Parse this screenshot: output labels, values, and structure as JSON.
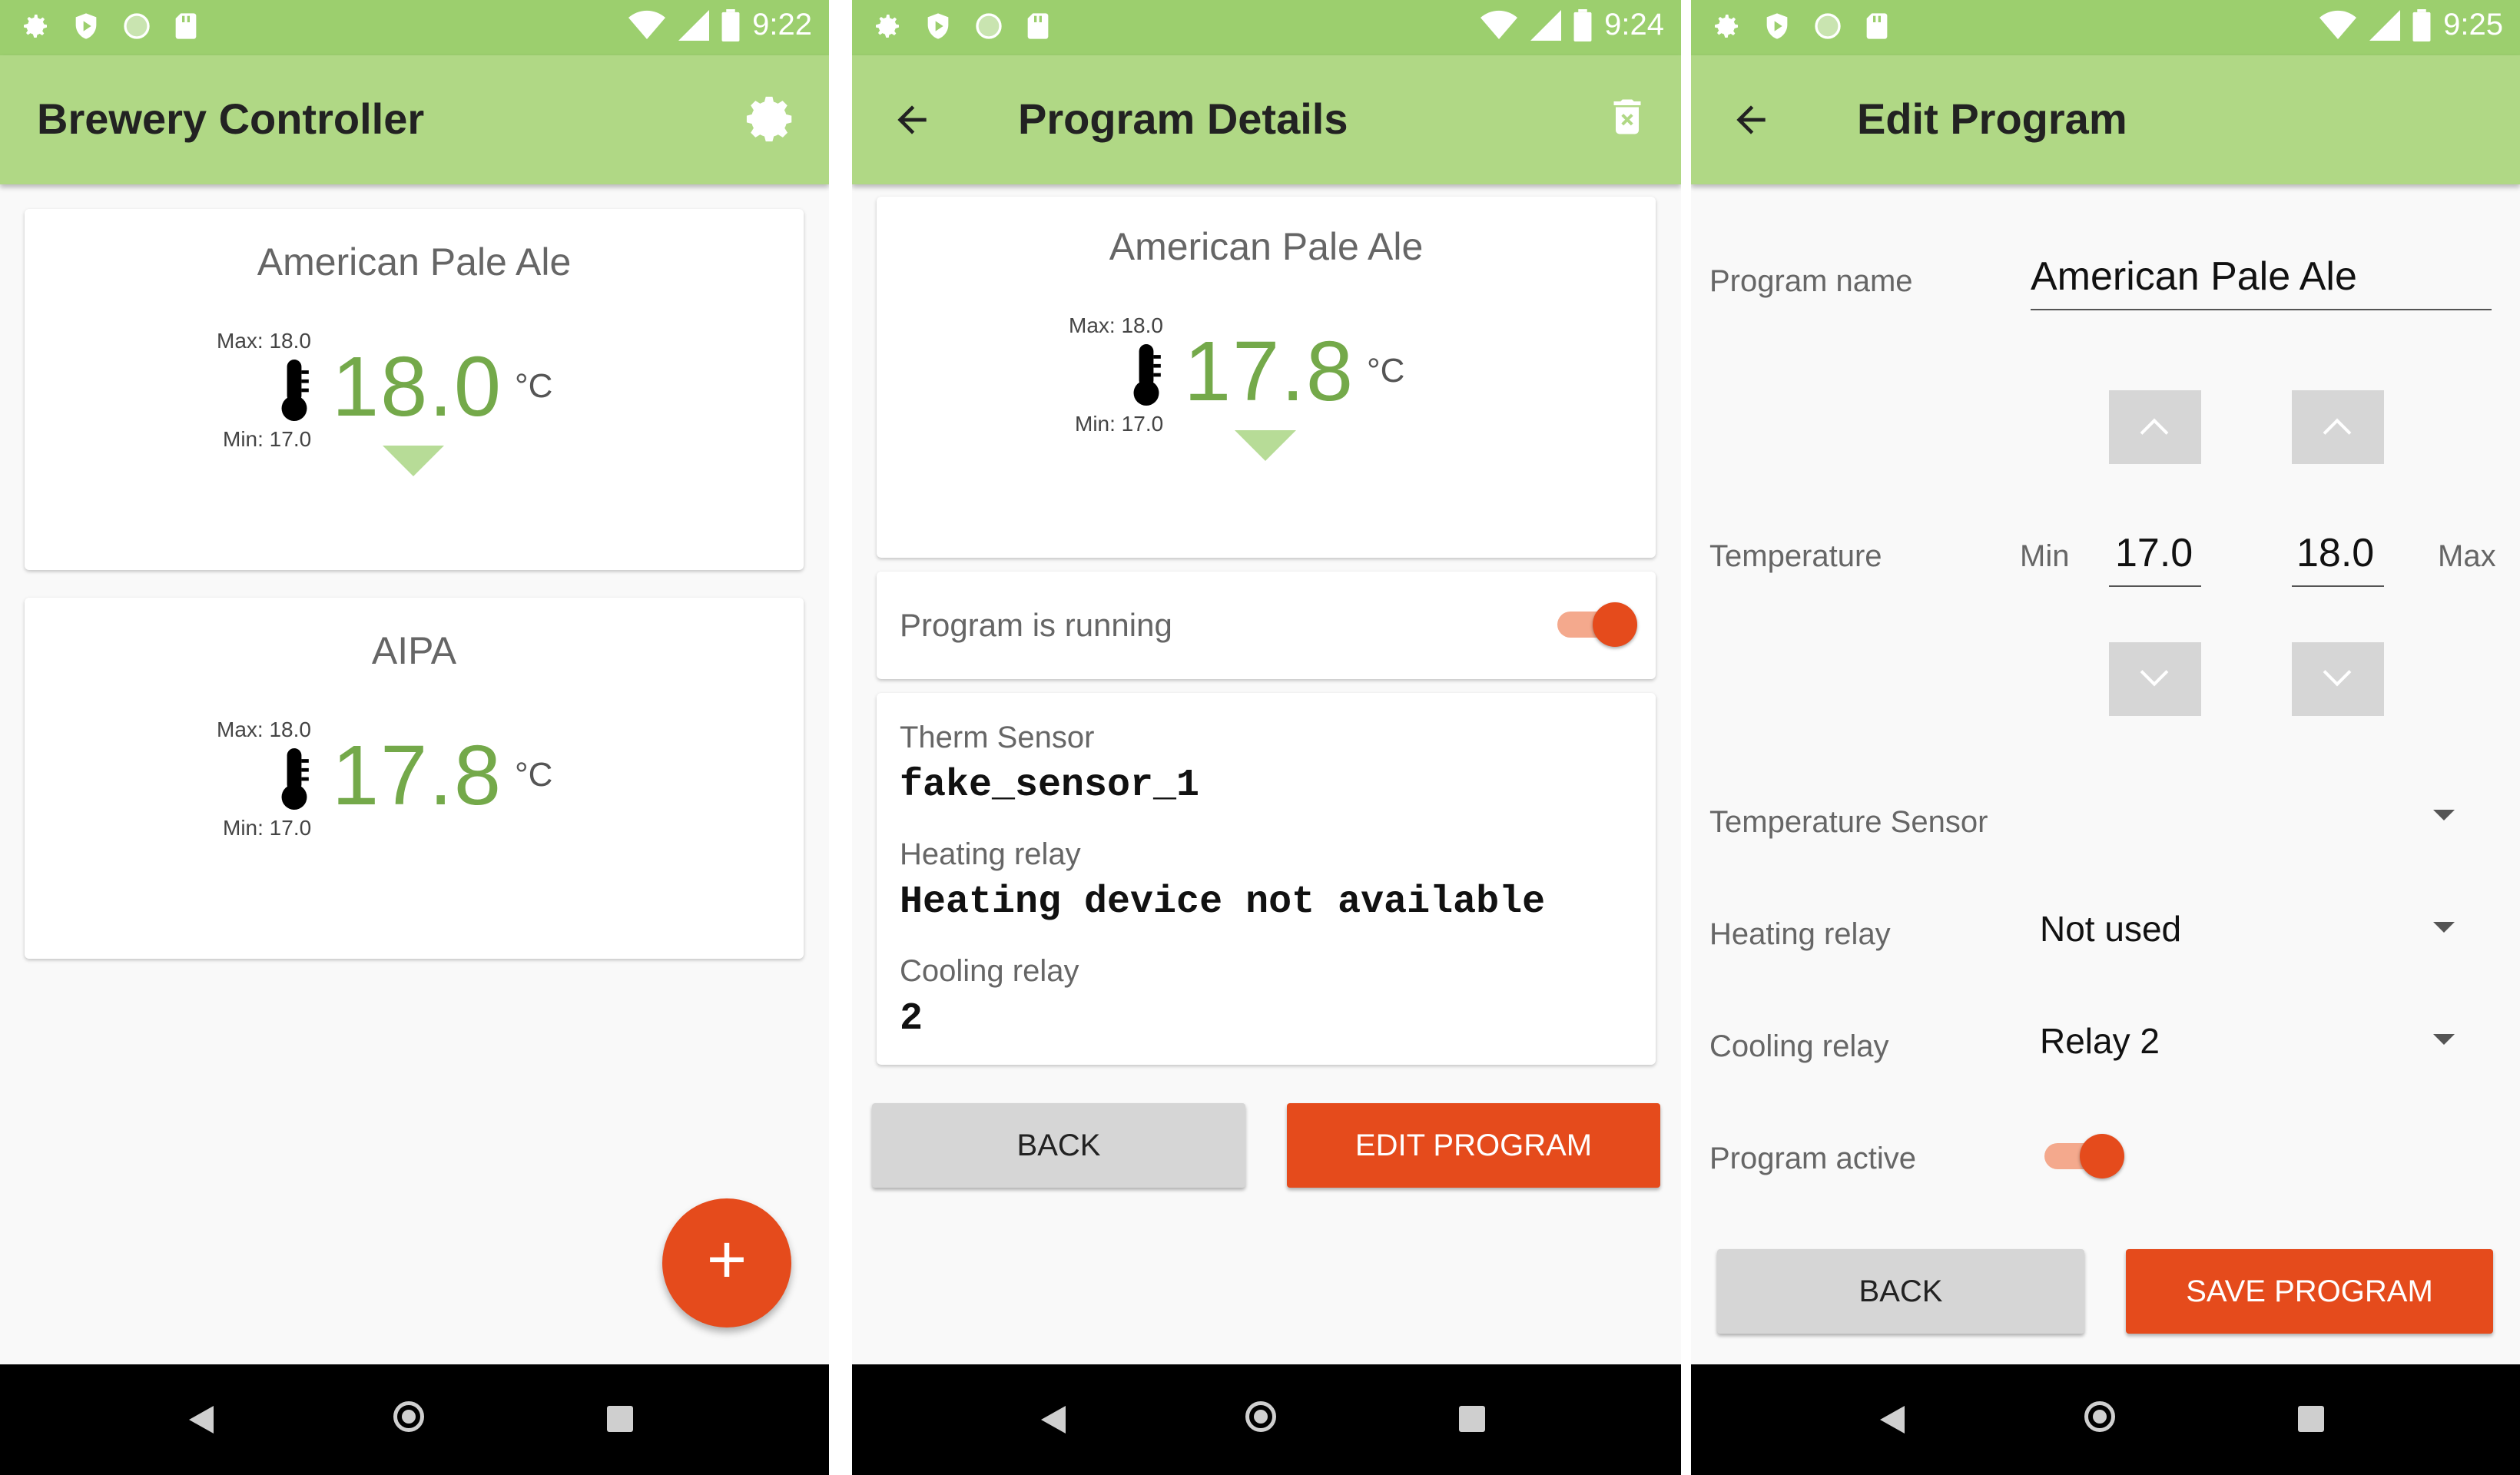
{
  "screen1": {
    "status": {
      "time": "9:22"
    },
    "appbar": {
      "title": "Brewery Controller",
      "settings_icon": "gear-icon"
    },
    "cards": [
      {
        "name": "American Pale Ale",
        "max": "Max: 18.0",
        "min": "Min: 17.0",
        "temp": "18.0",
        "unit": "°C"
      },
      {
        "name": "AIPA",
        "max": "Max: 18.0",
        "min": "Min: 17.0",
        "temp": "17.8",
        "unit": "°C"
      }
    ],
    "fab": {
      "label": "+"
    }
  },
  "screen2": {
    "status": {
      "time": "9:24"
    },
    "appbar": {
      "title": "Program Details",
      "delete_icon": "trash-icon"
    },
    "card": {
      "name": "American Pale Ale",
      "max": "Max: 18.0",
      "min": "Min: 17.0",
      "temp": "17.8",
      "unit": "°C"
    },
    "running_label": "Program is running",
    "info": {
      "therm_label": "Therm Sensor",
      "therm_value": "fake_sensor_1",
      "heating_label": "Heating relay",
      "heating_value": "Heating device not available",
      "cooling_label": "Cooling relay",
      "cooling_value": "2"
    },
    "buttons": {
      "back": "BACK",
      "edit": "EDIT PROGRAM"
    }
  },
  "screen3": {
    "status": {
      "time": "9:25"
    },
    "appbar": {
      "title": "Edit Program"
    },
    "program_name_label": "Program name",
    "program_name_value": "American Pale Ale",
    "temperature_label": "Temperature",
    "min_label": "Min",
    "min_value": "17.0",
    "max_label": "Max",
    "max_value": "18.0",
    "temp_sensor_label": "Temperature Sensor",
    "heating_label": "Heating relay",
    "heating_value": "Not used",
    "cooling_label": "Cooling relay",
    "cooling_value": "Relay 2",
    "active_label": "Program active",
    "buttons": {
      "back": "BACK",
      "save": "SAVE PROGRAM"
    }
  },
  "colors": {
    "statusbar": "#9ccf6e",
    "appbar": "#b0d885",
    "accent": "#e54b1c",
    "temp_green": "#74a94a"
  }
}
